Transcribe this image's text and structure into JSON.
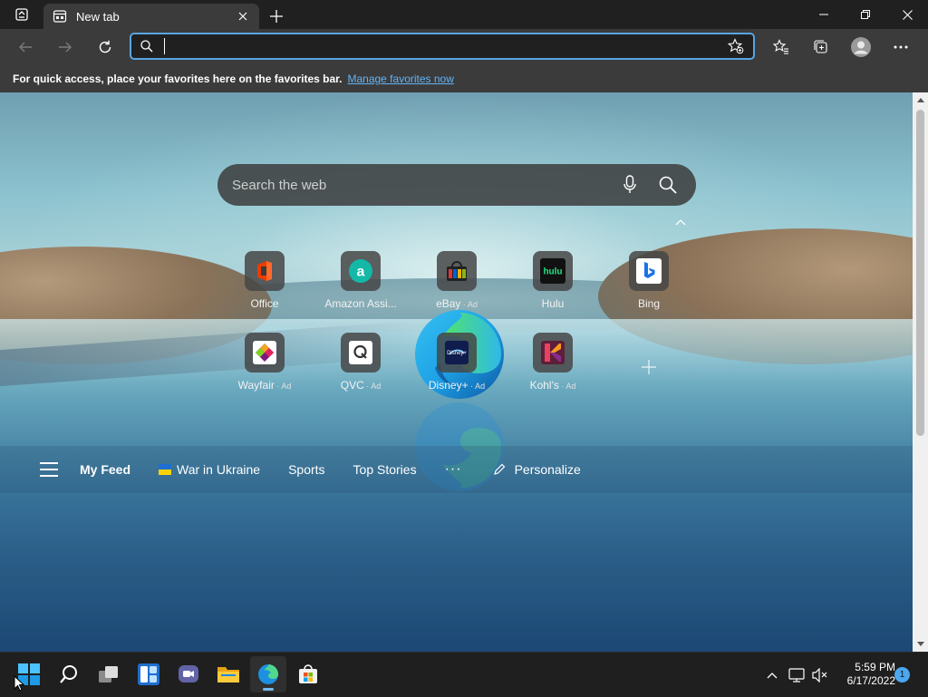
{
  "tab": {
    "title": "New tab"
  },
  "address": {
    "value": "",
    "placeholder": ""
  },
  "favbar": {
    "message": "For quick access, place your favorites here on the favorites bar.",
    "link": "Manage favorites now"
  },
  "search": {
    "placeholder": "Search the web"
  },
  "tiles": [
    {
      "label": "Office",
      "ad": ""
    },
    {
      "label": "Amazon Assi...",
      "ad": ""
    },
    {
      "label": "eBay",
      "ad": " · Ad"
    },
    {
      "label": "Hulu",
      "ad": ""
    },
    {
      "label": "Bing",
      "ad": ""
    },
    {
      "label": "Wayfair",
      "ad": " · Ad"
    },
    {
      "label": "QVC",
      "ad": " · Ad"
    },
    {
      "label": "Disney+",
      "ad": " · Ad"
    },
    {
      "label": "Kohl's",
      "ad": " · Ad"
    }
  ],
  "feed": {
    "my_feed": "My Feed",
    "items": [
      "War in Ukraine",
      "Sports",
      "Top Stories"
    ],
    "more": "···",
    "personalize": "Personalize"
  },
  "taskbar": {
    "time": "5:59 PM",
    "date": "6/17/2022",
    "notifications": "1"
  },
  "colors": {
    "accent": "#5aa5e0",
    "link": "#64b4f6",
    "chrome": "#3b3b3b",
    "titlebar": "#202020"
  }
}
